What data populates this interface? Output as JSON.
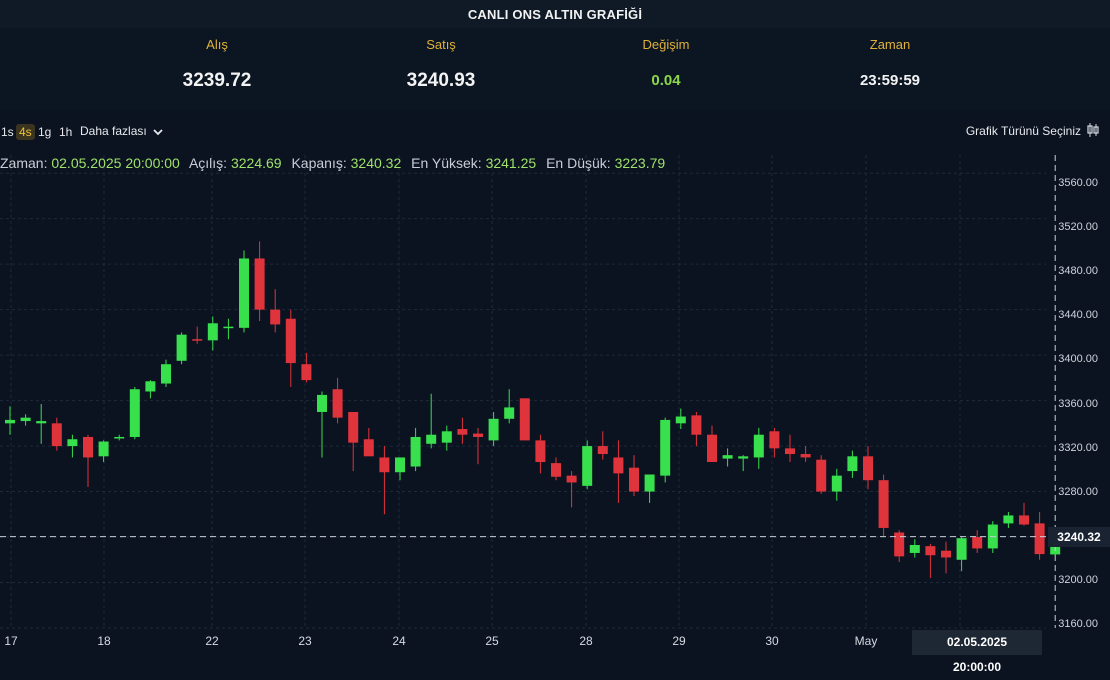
{
  "title": "CANLI ONS ALTIN GRAFİĞİ",
  "quote": {
    "bid_label": "Alış",
    "bid_value": "3239.72",
    "ask_label": "Satış",
    "ask_value": "3240.93",
    "change_label": "Değişim",
    "change_value": "0.04",
    "time_label": "Zaman",
    "time_value": "23:59:59"
  },
  "toolbar": {
    "timeframes": [
      "1s",
      "4s",
      "1g",
      "1h"
    ],
    "active_timeframe": "4s",
    "more_label": "Daha fazlası",
    "chart_type_label": "Grafik Türünü Seçiniz"
  },
  "legend": {
    "time_label": "Zaman:",
    "time_value": "02.05.2025 20:00:00",
    "open_label": "Açılış:",
    "open_value": "3224.69",
    "close_label": "Kapanış:",
    "close_value": "3240.32",
    "high_label": "En Yüksek:",
    "high_value": "3241.25",
    "low_label": "En Düşük:",
    "low_value": "3223.79"
  },
  "crosshair": {
    "price": "3240.32",
    "date": "02.05.2025",
    "time": "20:00:00"
  },
  "colors": {
    "up": "#39e04d",
    "down": "#e0343c",
    "background": "#0b1220",
    "accent": "#e0b13a"
  },
  "chart_data": {
    "type": "candlestick",
    "y_ticks": [
      "3560.00",
      "3520.00",
      "3480.00",
      "3440.00",
      "3400.00",
      "3360.00",
      "3320.00",
      "3280.00",
      "3240.00",
      "3200.00",
      "3160.00"
    ],
    "ylim": [
      3160,
      3576
    ],
    "x_tick_labels": [
      "17",
      "18",
      "22",
      "23",
      "24",
      "25",
      "28",
      "29",
      "30",
      "May"
    ],
    "grid": true,
    "candles": [
      {
        "o": 3340,
        "h": 3355,
        "l": 3330,
        "c": 3343
      },
      {
        "o": 3342,
        "h": 3348,
        "l": 3338,
        "c": 3345
      },
      {
        "o": 3340,
        "h": 3357,
        "l": 3322,
        "c": 3342
      },
      {
        "o": 3340,
        "h": 3345,
        "l": 3316,
        "c": 3320
      },
      {
        "o": 3320,
        "h": 3330,
        "l": 3310,
        "c": 3326
      },
      {
        "o": 3328,
        "h": 3330,
        "l": 3284,
        "c": 3310
      },
      {
        "o": 3311,
        "h": 3325,
        "l": 3306,
        "c": 3324
      },
      {
        "o": 3327,
        "h": 3330,
        "l": 3325,
        "c": 3328
      },
      {
        "o": 3328,
        "h": 3372,
        "l": 3326,
        "c": 3370
      },
      {
        "o": 3368,
        "h": 3378,
        "l": 3362,
        "c": 3377
      },
      {
        "o": 3375,
        "h": 3396,
        "l": 3372,
        "c": 3392
      },
      {
        "o": 3395,
        "h": 3420,
        "l": 3392,
        "c": 3418
      },
      {
        "o": 3414,
        "h": 3425,
        "l": 3410,
        "c": 3413
      },
      {
        "o": 3413,
        "h": 3434,
        "l": 3404,
        "c": 3428
      },
      {
        "o": 3425,
        "h": 3432,
        "l": 3414,
        "c": 3425
      },
      {
        "o": 3424,
        "h": 3492,
        "l": 3420,
        "c": 3485
      },
      {
        "o": 3485,
        "h": 3500,
        "l": 3430,
        "c": 3440
      },
      {
        "o": 3440,
        "h": 3458,
        "l": 3420,
        "c": 3427
      },
      {
        "o": 3432,
        "h": 3440,
        "l": 3372,
        "c": 3393
      },
      {
        "o": 3392,
        "h": 3402,
        "l": 3376,
        "c": 3378
      },
      {
        "o": 3350,
        "h": 3368,
        "l": 3310,
        "c": 3365
      },
      {
        "o": 3370,
        "h": 3380,
        "l": 3340,
        "c": 3345
      },
      {
        "o": 3350,
        "h": 3350,
        "l": 3298,
        "c": 3323
      },
      {
        "o": 3326,
        "h": 3336,
        "l": 3312,
        "c": 3311
      },
      {
        "o": 3310,
        "h": 3320,
        "l": 3260,
        "c": 3297
      },
      {
        "o": 3297,
        "h": 3308,
        "l": 3290,
        "c": 3310
      },
      {
        "o": 3302,
        "h": 3336,
        "l": 3298,
        "c": 3328
      },
      {
        "o": 3322,
        "h": 3366,
        "l": 3318,
        "c": 3330
      },
      {
        "o": 3323,
        "h": 3338,
        "l": 3316,
        "c": 3333
      },
      {
        "o": 3335,
        "h": 3345,
        "l": 3322,
        "c": 3330
      },
      {
        "o": 3331,
        "h": 3336,
        "l": 3304,
        "c": 3328
      },
      {
        "o": 3325,
        "h": 3350,
        "l": 3320,
        "c": 3344
      },
      {
        "o": 3344,
        "h": 3370,
        "l": 3340,
        "c": 3354
      },
      {
        "o": 3362,
        "h": 3362,
        "l": 3326,
        "c": 3325
      },
      {
        "o": 3325,
        "h": 3330,
        "l": 3296,
        "c": 3306
      },
      {
        "o": 3305,
        "h": 3310,
        "l": 3290,
        "c": 3293
      },
      {
        "o": 3294,
        "h": 3298,
        "l": 3266,
        "c": 3288
      },
      {
        "o": 3285,
        "h": 3325,
        "l": 3282,
        "c": 3320
      },
      {
        "o": 3320,
        "h": 3333,
        "l": 3308,
        "c": 3313
      },
      {
        "o": 3310,
        "h": 3325,
        "l": 3270,
        "c": 3296
      },
      {
        "o": 3301,
        "h": 3312,
        "l": 3276,
        "c": 3280
      },
      {
        "o": 3280,
        "h": 3290,
        "l": 3270,
        "c": 3295
      },
      {
        "o": 3294,
        "h": 3345,
        "l": 3288,
        "c": 3343
      },
      {
        "o": 3340,
        "h": 3353,
        "l": 3335,
        "c": 3346
      },
      {
        "o": 3347,
        "h": 3350,
        "l": 3320,
        "c": 3330
      },
      {
        "o": 3330,
        "h": 3338,
        "l": 3306,
        "c": 3306
      },
      {
        "o": 3309,
        "h": 3318,
        "l": 3302,
        "c": 3312
      },
      {
        "o": 3309,
        "h": 3312,
        "l": 3298,
        "c": 3311
      },
      {
        "o": 3310,
        "h": 3336,
        "l": 3300,
        "c": 3330
      },
      {
        "o": 3333,
        "h": 3336,
        "l": 3310,
        "c": 3318
      },
      {
        "o": 3318,
        "h": 3330,
        "l": 3306,
        "c": 3313
      },
      {
        "o": 3313,
        "h": 3320,
        "l": 3306,
        "c": 3310
      },
      {
        "o": 3308,
        "h": 3312,
        "l": 3278,
        "c": 3280
      },
      {
        "o": 3280,
        "h": 3300,
        "l": 3272,
        "c": 3294
      },
      {
        "o": 3298,
        "h": 3316,
        "l": 3292,
        "c": 3311
      },
      {
        "o": 3311,
        "h": 3320,
        "l": 3282,
        "c": 3290
      },
      {
        "o": 3290,
        "h": 3295,
        "l": 3240,
        "c": 3248
      },
      {
        "o": 3244,
        "h": 3246,
        "l": 3218,
        "c": 3223
      },
      {
        "o": 3226,
        "h": 3238,
        "l": 3222,
        "c": 3233
      },
      {
        "o": 3232,
        "h": 3234,
        "l": 3204,
        "c": 3224
      },
      {
        "o": 3228,
        "h": 3236,
        "l": 3208,
        "c": 3222
      },
      {
        "o": 3220,
        "h": 3240,
        "l": 3210,
        "c": 3239
      },
      {
        "o": 3240,
        "h": 3246,
        "l": 3226,
        "c": 3230
      },
      {
        "o": 3230,
        "h": 3254,
        "l": 3226,
        "c": 3251
      },
      {
        "o": 3252,
        "h": 3262,
        "l": 3248,
        "c": 3259
      },
      {
        "o": 3259,
        "h": 3270,
        "l": 3250,
        "c": 3251
      },
      {
        "o": 3252,
        "h": 3262,
        "l": 3220,
        "c": 3225
      },
      {
        "o": 3224.69,
        "h": 3241.25,
        "l": 3223.79,
        "c": 3240.32
      }
    ]
  }
}
